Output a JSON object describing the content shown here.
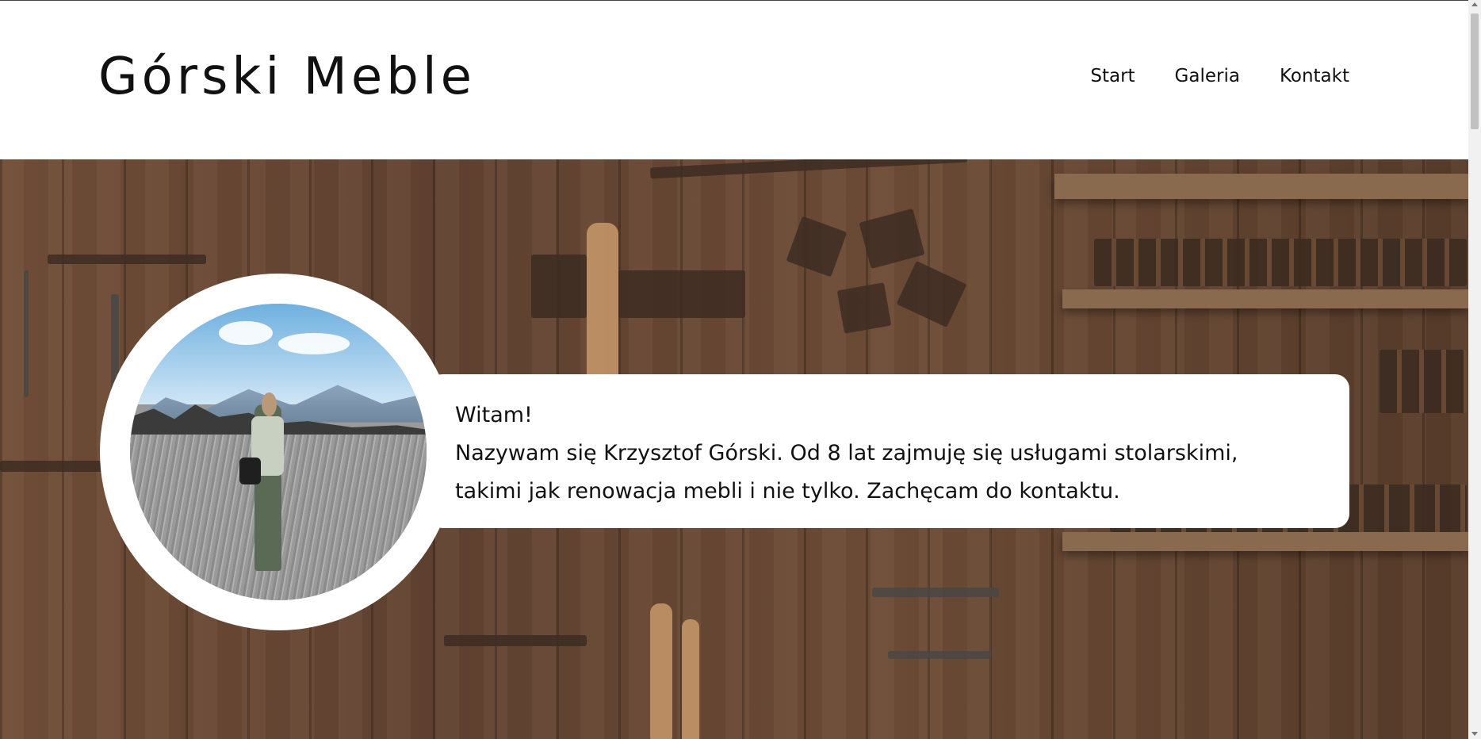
{
  "header": {
    "brand": "Górski Meble",
    "nav": [
      "Start",
      "Galeria",
      "Kontakt"
    ]
  },
  "intro": {
    "greeting": "Witam!",
    "text": "Nazywam się Krzysztof Górski. Od 8 lat zajmuję się usługami stolarskimi, takimi jak renowacja mebli i nie tylko. Zachęcam do kontaktu."
  },
  "icons": [
    "scroll-up-arrow-icon",
    "scroll-down-arrow-icon"
  ]
}
